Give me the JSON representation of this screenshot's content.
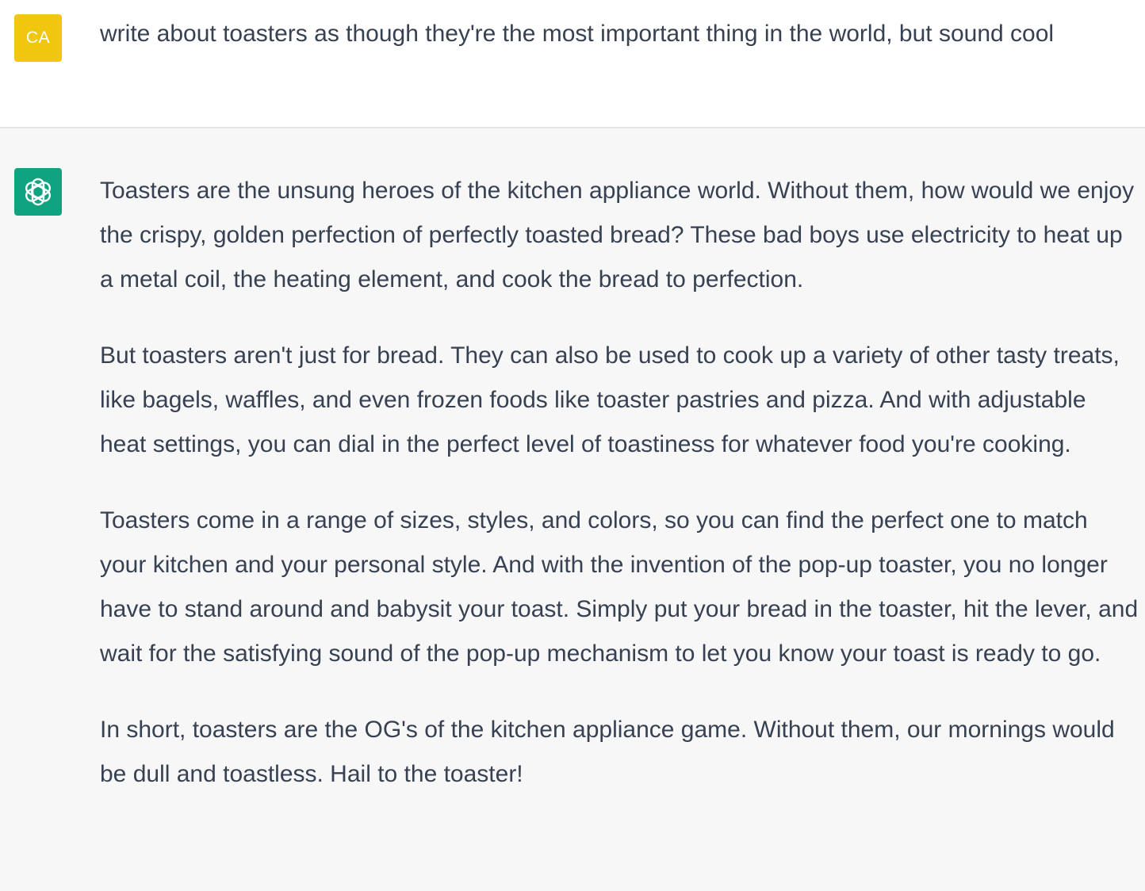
{
  "user_message": {
    "avatar_initials": "CA",
    "avatar_color": "#f0c70e",
    "text": "write about toasters as though they're the most important thing in the world, but sound cool"
  },
  "assistant_message": {
    "avatar_icon": "openai-logo-icon",
    "avatar_color": "#10a37f",
    "paragraphs": [
      "Toasters are the unsung heroes of the kitchen appliance world. Without them, how would we enjoy the crispy, golden perfection of perfectly toasted bread? These bad boys use electricity to heat up a metal coil, the heating element, and cook the bread to perfection.",
      "But toasters aren't just for bread. They can also be used to cook up a variety of other tasty treats, like bagels, waffles, and even frozen foods like toaster pastries and pizza. And with adjustable heat settings, you can dial in the perfect level of toastiness for whatever food you're cooking.",
      "Toasters come in a range of sizes, styles, and colors, so you can find the perfect one to match your kitchen and your personal style. And with the invention of the pop-up toaster, you no longer have to stand around and babysit your toast. Simply put your bread in the toaster, hit the lever, and wait for the satisfying sound of the pop-up mechanism to let you know your toast is ready to go.",
      "In short, toasters are the OG's of the kitchen appliance game. Without them, our mornings would be dull and toastless. Hail to the toaster!"
    ]
  }
}
